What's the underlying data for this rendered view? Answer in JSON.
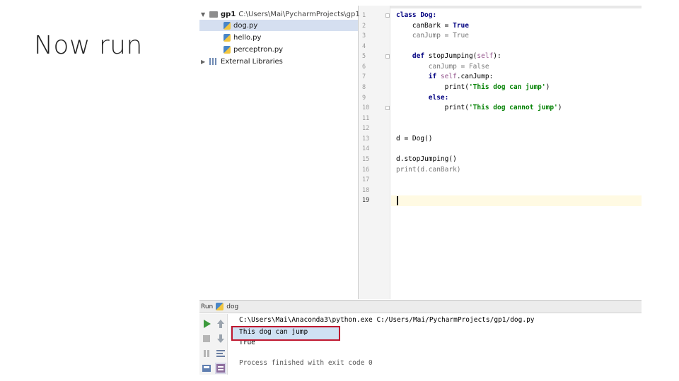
{
  "slide": {
    "title": "Now run"
  },
  "project": {
    "root_name": "gp1",
    "root_path": "C:\\Users\\Mai\\PycharmProjects\\gp1",
    "files": [
      "dog.py",
      "hello.py",
      "perceptron.py"
    ],
    "external_libraries": "External Libraries"
  },
  "editor": {
    "line_numbers": [
      "1",
      "2",
      "3",
      "4",
      "5",
      "6",
      "7",
      "8",
      "9",
      "10",
      "11",
      "12",
      "13",
      "14",
      "15",
      "16",
      "17",
      "18",
      "19"
    ],
    "lines": {
      "l1": "class Dog:",
      "l2a": "    canBark = ",
      "l2b": "True",
      "l3a": "    canJump = ",
      "l3b": "True",
      "l5a": "    def ",
      "l5b": "stopJumping(",
      "l5c": "self",
      "l5d": "):",
      "l6a": "        canJump = ",
      "l6b": "False",
      "l7a": "        if ",
      "l7b": "self",
      "l7c": ".canJump:",
      "l8a": "            print(",
      "l8b": "'This dog can jump'",
      "l8c": ")",
      "l9": "        else:",
      "l10a": "            print(",
      "l10b": "'This dog cannot jump'",
      "l10c": ")",
      "l13": "d = Dog()",
      "l15": "d.stopJumping()",
      "l16": "print(d.canBark)"
    },
    "current_line": 19
  },
  "run": {
    "label": "Run",
    "tab_name": "dog",
    "console": [
      "C:\\Users\\Mai\\Anaconda3\\python.exe C:/Users/Mai/PycharmProjects/gp1/dog.py",
      "This dog can jump",
      "True",
      "Process finished with exit code 0"
    ]
  },
  "colors": {
    "highlight_box": "#c0172f",
    "run_green": "#3c9a3c",
    "keyword": "#000080",
    "string": "#008000"
  }
}
